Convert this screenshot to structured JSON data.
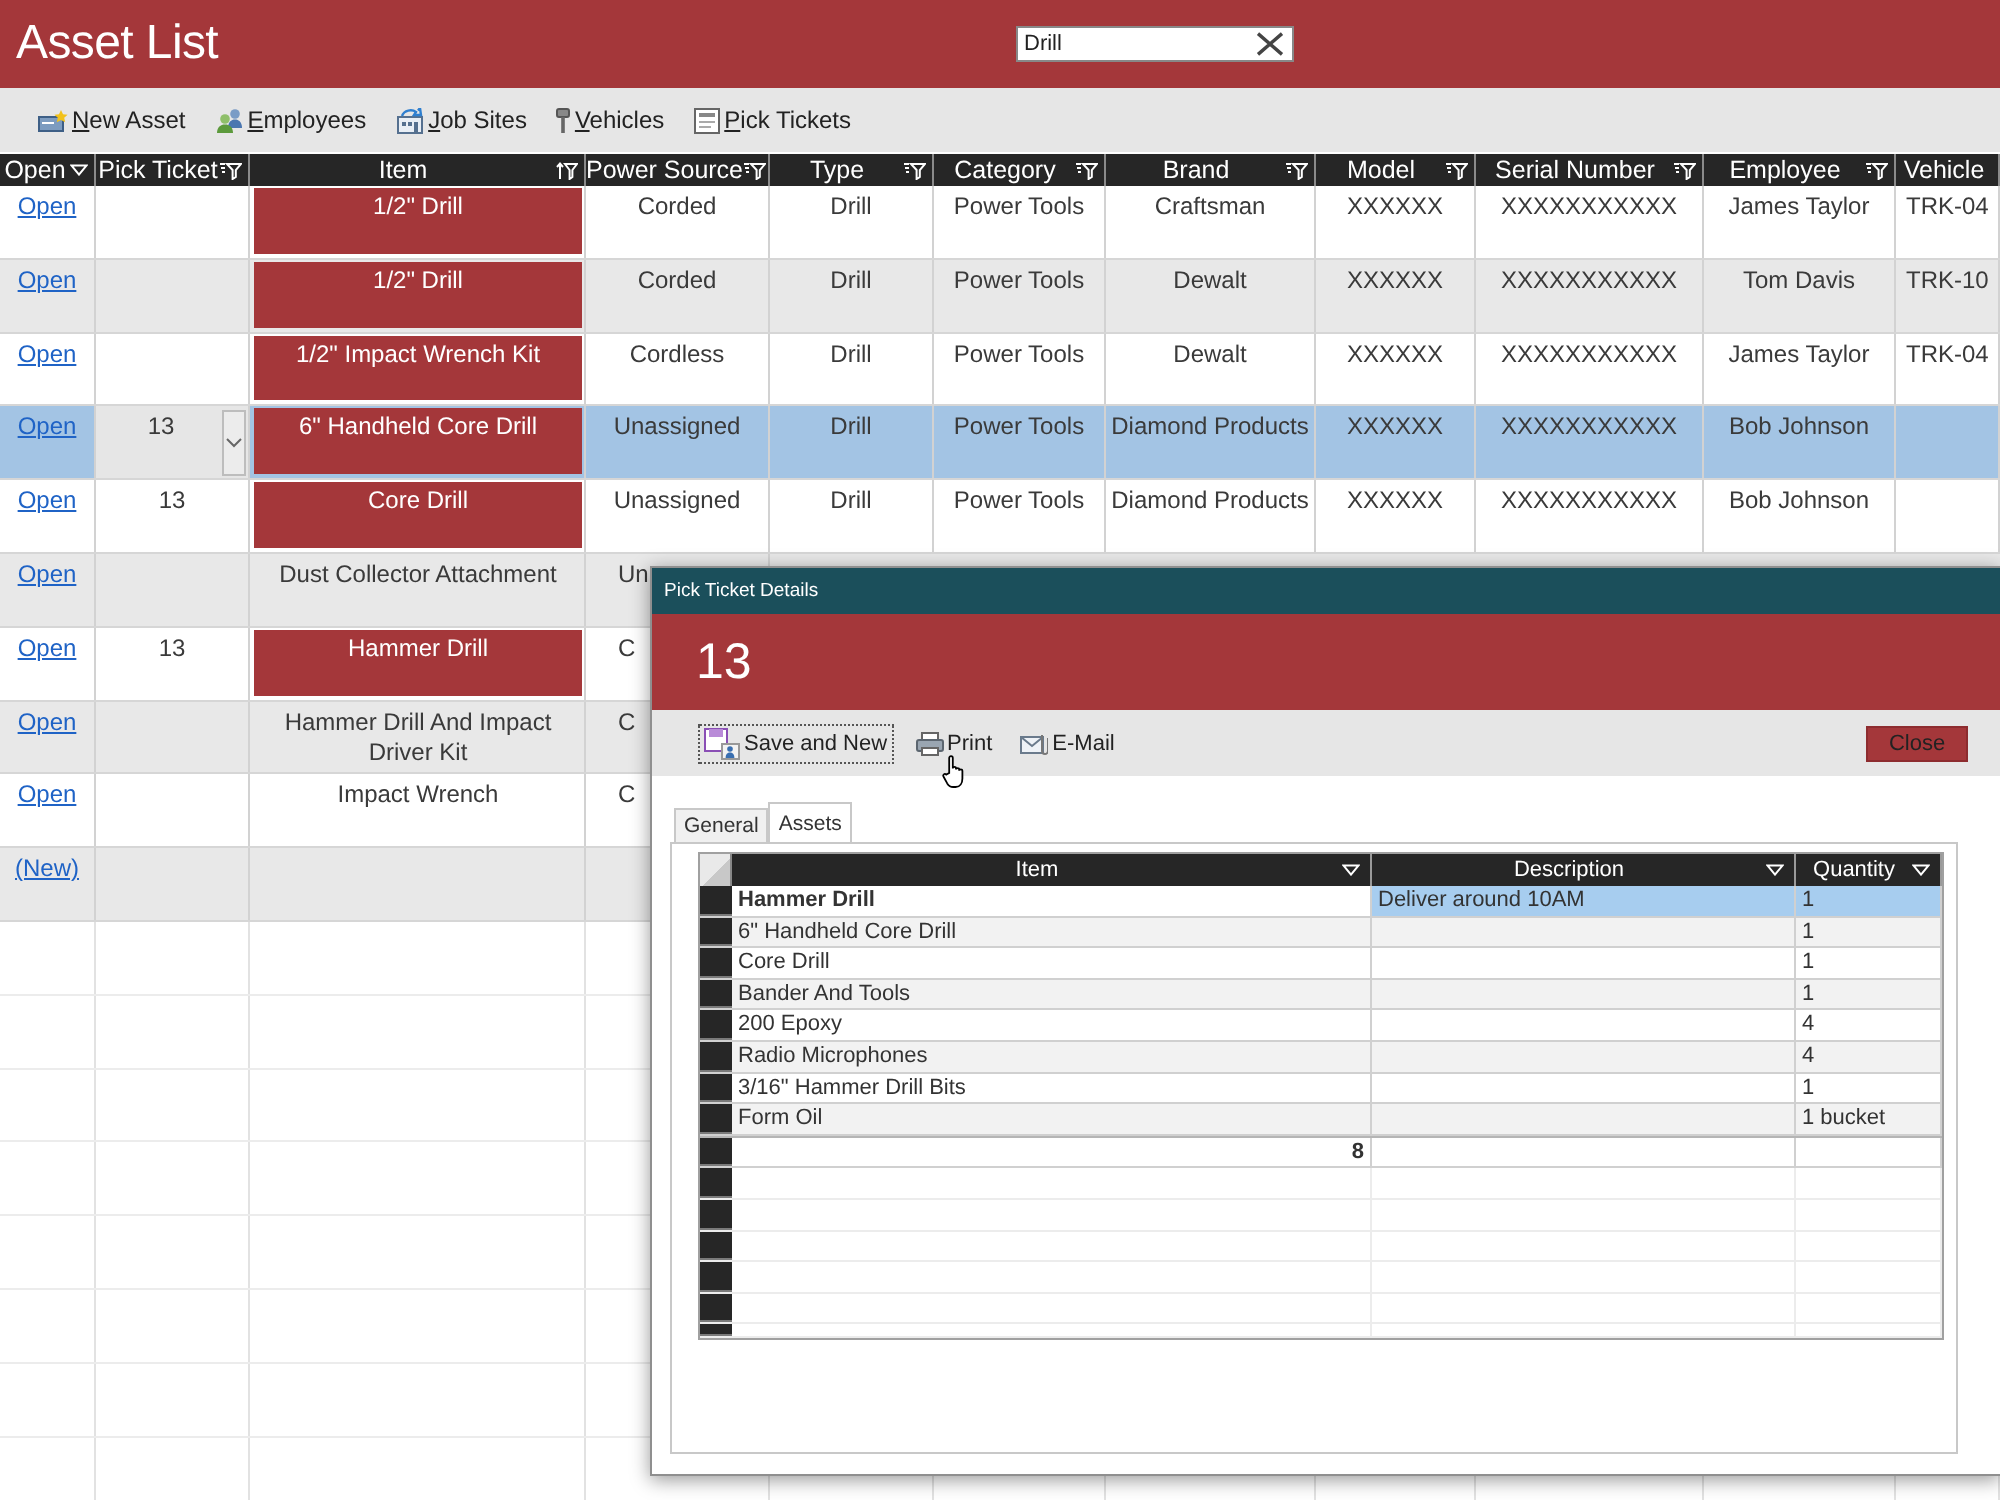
{
  "header": {
    "title": "Asset List",
    "search": {
      "value": "Drill"
    }
  },
  "toolbar": [
    "New Asset",
    "Employees",
    "Job Sites",
    "Vehicles",
    "Pick Tickets"
  ],
  "table": {
    "columns": [
      {
        "label": "Open",
        "filtered": false,
        "sorted": false
      },
      {
        "label": "Pick Ticket",
        "filtered": true,
        "sorted": false
      },
      {
        "label": "Item",
        "filtered": true,
        "sorted": true
      },
      {
        "label": "Power Source",
        "filtered": true,
        "sorted": false
      },
      {
        "label": "Type",
        "filtered": true,
        "sorted": false
      },
      {
        "label": "Category",
        "filtered": true,
        "sorted": false
      },
      {
        "label": "Brand",
        "filtered": true,
        "sorted": false
      },
      {
        "label": "Model",
        "filtered": true,
        "sorted": false
      },
      {
        "label": "Serial Number",
        "filtered": true,
        "sorted": false
      },
      {
        "label": "Employee",
        "filtered": true,
        "sorted": false
      },
      {
        "label": "Vehicle"
      }
    ],
    "rows": [
      {
        "selected": false,
        "item_highlighted": true,
        "cells": [
          "Open",
          null,
          "1/2\" Drill",
          "Corded",
          "Drill",
          "Power Tools",
          "Craftsman",
          "XXXXXX",
          "XXXXXXXXXXX",
          "James Taylor",
          "TRK-04"
        ]
      },
      {
        "selected": false,
        "item_highlighted": true,
        "cells": [
          "Open",
          null,
          "1/2\" Drill",
          "Corded",
          "Drill",
          "Power Tools",
          "Dewalt",
          "XXXXXX",
          "XXXXXXXXXXX",
          "Tom Davis",
          "TRK-10"
        ]
      },
      {
        "selected": false,
        "item_highlighted": true,
        "cells": [
          "Open",
          null,
          "1/2\" Impact Wrench Kit",
          "Cordless",
          "Drill",
          "Power Tools",
          "Dewalt",
          "XXXXXX",
          "XXXXXXXXXXX",
          "James Taylor",
          "TRK-04"
        ]
      },
      {
        "selected": true,
        "item_highlighted": true,
        "cells": [
          "Open",
          "13",
          "6\" Handheld Core Drill",
          "Unassigned",
          "Drill",
          "Power Tools",
          "Diamond Products",
          "XXXXXX",
          "XXXXXXXXXXX",
          "Bob Johnson",
          null
        ]
      },
      {
        "selected": false,
        "item_highlighted": true,
        "cells": [
          "Open",
          "13",
          "Core Drill",
          "Unassigned",
          "Drill",
          "Power Tools",
          "Diamond Products",
          "XXXXXX",
          "XXXXXXXXXXX",
          "Bob Johnson",
          null
        ]
      },
      {
        "selected": false,
        "item_highlighted": false,
        "cells": [
          "Open",
          null,
          "Dust Collector Attachment",
          "Un"
        ]
      },
      {
        "selected": false,
        "item_highlighted": true,
        "cells": [
          "Open",
          "13",
          "Hammer Drill",
          "C"
        ]
      },
      {
        "selected": false,
        "item_highlighted": false,
        "cells": [
          "Open",
          null,
          "Hammer Drill And Impact Driver Kit",
          "C"
        ]
      },
      {
        "selected": false,
        "item_highlighted": false,
        "cells": [
          "Open",
          null,
          "Impact Wrench",
          "C"
        ]
      },
      {
        "selected": false,
        "item_highlighted": false,
        "cells": [
          "(New)",
          null,
          null,
          null
        ]
      }
    ]
  },
  "dialog": {
    "title": "Pick Ticket Details",
    "heading": "13",
    "actions": [
      {
        "label": "Save and New",
        "focused": true
      },
      {
        "label": "Print",
        "focused": false
      },
      {
        "label": "E-Mail",
        "focused": false
      }
    ],
    "close_label": "Close",
    "tabs": [
      {
        "label": "General",
        "selected": false
      },
      {
        "label": "Assets",
        "selected": true
      }
    ],
    "assets_grid": {
      "columns": [
        "Item",
        "Description",
        "Quantity"
      ],
      "rows": [
        {
          "item": "Hammer Drill",
          "description": "Deliver around 10AM",
          "quantity": "1",
          "selected": true
        },
        {
          "item": "6\" Handheld Core Drill",
          "quantity": "1",
          "selected": false
        },
        {
          "item": "Core Drill",
          "quantity": "1",
          "selected": false
        },
        {
          "item": "Bander And Tools",
          "quantity": "1",
          "selected": false
        },
        {
          "item": "200 Epoxy",
          "quantity": "4",
          "selected": false
        },
        {
          "item": "Radio Microphones",
          "quantity": "4",
          "selected": false
        },
        {
          "item": "3/16\" Hammer Drill Bits",
          "quantity": "1",
          "selected": false
        },
        {
          "item": "Form Oil",
          "quantity": "1 bucket",
          "selected": false
        }
      ],
      "total": "8"
    }
  }
}
